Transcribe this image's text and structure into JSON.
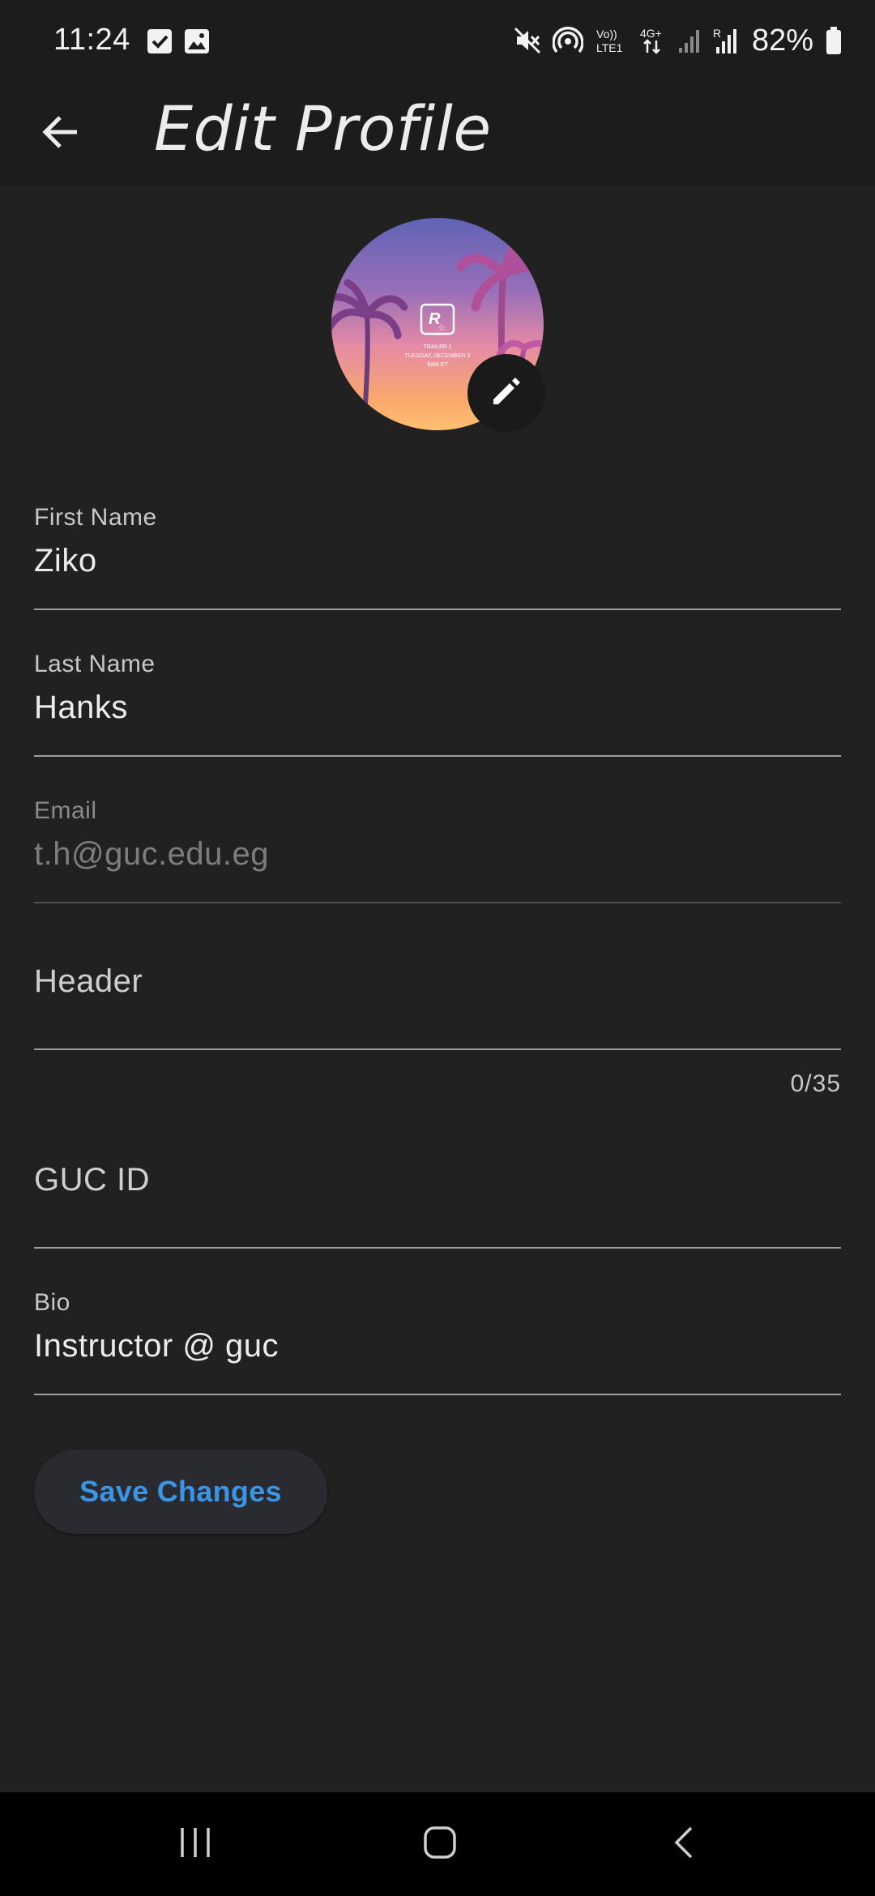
{
  "status_bar": {
    "time": "11:24",
    "battery": "82%",
    "network_labels": {
      "volte": "Vo)) LTE1",
      "data": "4G+",
      "roaming": "R"
    }
  },
  "app_bar": {
    "title": "Edit Profile",
    "back_icon": "arrow-back-icon"
  },
  "avatar": {
    "edit_icon": "pencil-icon",
    "image_text_lines": [
      "TRAILER 1",
      "TUESDAY, DECEMBER 5",
      "9AM ET"
    ]
  },
  "form": {
    "first_name": {
      "label": "First Name",
      "value": "Ziko"
    },
    "last_name": {
      "label": "Last Name",
      "value": "Hanks"
    },
    "email": {
      "label": "Email",
      "value": "t.h@guc.edu.eg",
      "disabled": true
    },
    "header": {
      "placeholder": "Header",
      "value": "",
      "counter": "0/35"
    },
    "guc_id": {
      "placeholder": "GUC ID",
      "value": ""
    },
    "bio": {
      "label": "Bio",
      "value": "Instructor @ guc"
    }
  },
  "actions": {
    "save_label": "Save Changes"
  },
  "colors": {
    "background": "#212121",
    "app_bar": "#1c1c1e",
    "accent": "#3b95e6",
    "underline": "#9e9e9e"
  },
  "nav_bar": {
    "recents_icon": "recents-icon",
    "home_icon": "home-icon",
    "back_icon": "nav-back-icon"
  }
}
